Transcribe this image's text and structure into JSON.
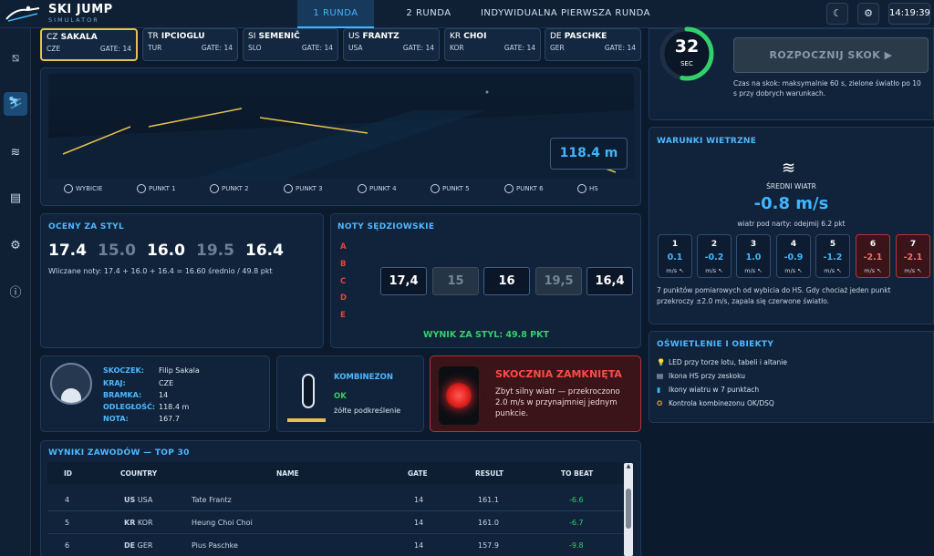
{
  "app": {
    "title": "SKI JUMP",
    "subtitle": "SIMULATOR"
  },
  "tabs": [
    "1 RUNDA",
    "2 RUNDA",
    "INDYWIDUALNA PIERWSZA RUNDA"
  ],
  "top": {
    "theme_icon": "☾",
    "settings_icon": "⚙",
    "clock": "14:19:39"
  },
  "sidebar": [
    "⧅",
    "⛷",
    "≋",
    "▤",
    "⚙",
    "ⓘ"
  ],
  "jumpers": [
    {
      "cc": "CZ",
      "name": "SAKALA",
      "country": "CZE",
      "gate": "GATE: 14"
    },
    {
      "cc": "TR",
      "name": "IPCIOGLU",
      "country": "TUR",
      "gate": "GATE: 14"
    },
    {
      "cc": "SI",
      "name": "SEMENIČ",
      "country": "SLO",
      "gate": "GATE: 14"
    },
    {
      "cc": "US",
      "name": "FRANTZ",
      "country": "USA",
      "gate": "GATE: 14"
    },
    {
      "cc": "KR",
      "name": "CHOI",
      "country": "KOR",
      "gate": "GATE: 14"
    },
    {
      "cc": "DE",
      "name": "PASCHKE",
      "country": "GER",
      "gate": "GATE: 14"
    }
  ],
  "track": {
    "distance": "118.4 m",
    "points": [
      "WYBICIE",
      "PUNKT 1",
      "PUNKT 2",
      "PUNKT 3",
      "PUNKT 4",
      "PUNKT 5",
      "PUNKT 6",
      "HS"
    ]
  },
  "timer": {
    "value": "32",
    "unit": "SEC",
    "progress": 0.53,
    "start_label": "ROZPOCZNIJ SKOK ▶",
    "note": "Czas na skok: maksymalnie 60 s, zielone światło po 10 s przy dobrych warunkach."
  },
  "style": {
    "title": "OCENY ZA STYL",
    "scores": [
      "17.4",
      "15.0",
      "16.0",
      "19.5",
      "16.4"
    ],
    "summary": "Wliczane noty: 17.4 + 16.0 + 16.4 = 16.60 średnio / 49.8 pkt"
  },
  "judges": {
    "title": "NOTY SĘDZIOWSKIE",
    "letters": [
      "A",
      "B",
      "C",
      "D",
      "E"
    ],
    "values": [
      "17,4",
      "15",
      "16",
      "19,5",
      "16,4"
    ],
    "result": "WYNIK ZA STYL: 49.8 PKT"
  },
  "jumper_info": {
    "labels": [
      "SKOCZEK:",
      "KRAJ:",
      "BRAMKA:",
      "ODLEGŁOŚĆ:",
      "NOTA:"
    ],
    "values": [
      "Filip Sakala",
      "CZE",
      "14",
      "118.4 m",
      "167.7"
    ]
  },
  "kombinezon": {
    "title": "KOMBINEZON",
    "status": "OK",
    "desc": "żółte podkreślenie"
  },
  "closed": {
    "title": "SKOCZNIA ZAMKNIĘTA",
    "desc": "Zbyt silny wiatr — przekroczono 2.0 m/s w przynajmniej jednym punkcie."
  },
  "wind": {
    "title": "WARUNKI WIETRZNE",
    "icon": "≋",
    "avg_label": "ŚREDNI WIATR",
    "avg_value": "-0.8 m/s",
    "avg_note": "wiatr pod narty: odejmij 6.2 pkt",
    "points": [
      {
        "n": "1",
        "v": "0.1",
        "u": "m/s ↖",
        "red": false
      },
      {
        "n": "2",
        "v": "-0.2",
        "u": "m/s ↖",
        "red": false
      },
      {
        "n": "3",
        "v": "1.0",
        "u": "m/s ↖",
        "red": false
      },
      {
        "n": "4",
        "v": "-0.9",
        "u": "m/s ↖",
        "red": false
      },
      {
        "n": "5",
        "v": "-1.2",
        "u": "m/s ↖",
        "red": false
      },
      {
        "n": "6",
        "v": "-2.1",
        "u": "m/s ↖",
        "red": true
      },
      {
        "n": "7",
        "v": "-2.1",
        "u": "m/s ↖",
        "red": true
      }
    ],
    "note": "7 punktów pomiarowych od wybicia do HS. Gdy chociaż jeden punkt przekroczy ±2.0 m/s, zapala się czerwone światło."
  },
  "lighting": {
    "title": "OŚWIETLENIE I OBIEKTY",
    "items": [
      {
        "icon": "💡",
        "text": "LED przy torze lotu, tabeli i altanie"
      },
      {
        "icon": "▤",
        "text": "Ikona HS przy zeskoku"
      },
      {
        "icon": "▮",
        "text": "Ikony wiatru w 7 punktach"
      },
      {
        "icon": "✪",
        "text": "Kontrola kombinezonu OK/DSQ"
      }
    ]
  },
  "results": {
    "title": "WYNIKI ZAWODÓW — TOP 30",
    "headers": [
      "ID",
      "COUNTRY",
      "NAME",
      "GATE",
      "RESULT",
      "TO BEAT"
    ],
    "rows": [
      {
        "id": "4",
        "cc": "US",
        "country": "USA",
        "name": "Tate Frantz",
        "gate": "14",
        "result": "161.1",
        "tobeat": "-6.6"
      },
      {
        "id": "5",
        "cc": "KR",
        "country": "KOR",
        "name": "Heung Choi Choi",
        "gate": "14",
        "result": "161.0",
        "tobeat": "-6.7"
      },
      {
        "id": "6",
        "cc": "DE",
        "country": "GER",
        "name": "Pius Paschke",
        "gate": "14",
        "result": "157.9",
        "tobeat": "-9.8"
      }
    ]
  },
  "colors": {
    "accent": "#3fb6ff",
    "green": "#33d06a",
    "red": "#e6443a",
    "yellow": "#e6c24a"
  }
}
